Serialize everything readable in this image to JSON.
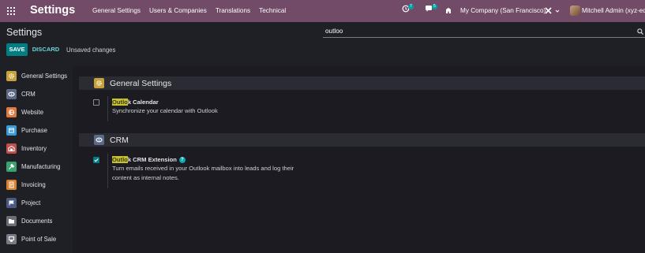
{
  "app": {
    "title": "Settings"
  },
  "nav": {
    "menu": [
      "General Settings",
      "Users & Companies",
      "Translations",
      "Technical"
    ],
    "activity_count": "7",
    "messages_count": "5",
    "company": "My Company (San Francisco)",
    "user": "Mitchell Admin (xyz-eq)"
  },
  "control_panel": {
    "title": "Settings",
    "search_value": "outloo",
    "save_label": "SAVE",
    "discard_label": "DISCARD",
    "status": "Unsaved changes"
  },
  "sidebar": {
    "items": [
      {
        "label": "General Settings",
        "icon": "gear-icon",
        "color": "#c8a03c"
      },
      {
        "label": "CRM",
        "icon": "crm-icon",
        "color": "#5c6a8a"
      },
      {
        "label": "Website",
        "icon": "website-icon",
        "color": "#e07a3f"
      },
      {
        "label": "Purchase",
        "icon": "purchase-icon",
        "color": "#3a9bd9"
      },
      {
        "label": "Inventory",
        "icon": "inventory-icon",
        "color": "#c0504d"
      },
      {
        "label": "Manufacturing",
        "icon": "manufacturing-icon",
        "color": "#3aa36d"
      },
      {
        "label": "Invoicing",
        "icon": "invoicing-icon",
        "color": "#d9822b"
      },
      {
        "label": "Project",
        "icon": "project-icon",
        "color": "#4a5a82"
      },
      {
        "label": "Documents",
        "icon": "documents-icon",
        "color": "#6d6d78"
      },
      {
        "label": "Point of Sale",
        "icon": "pos-icon",
        "color": "#7a7a88"
      }
    ]
  },
  "sections": {
    "general": {
      "title": "General Settings",
      "setting": {
        "title_highlight": "Outlo",
        "title_rest": "k Calendar",
        "desc": "Synchronize your calendar with Outlook",
        "checked": false
      }
    },
    "crm": {
      "title": "CRM",
      "setting": {
        "title_highlight": "Outlo",
        "title_rest": "k CRM Extension",
        "help": "?",
        "desc_line1": "Turn emails received in your Outlook mailbox into leads and log their",
        "desc_line2": "content as internal notes.",
        "checked": true
      }
    }
  },
  "colors": {
    "topbar": "#714b67",
    "primary": "#017e84",
    "highlight": "#c9c12a"
  }
}
